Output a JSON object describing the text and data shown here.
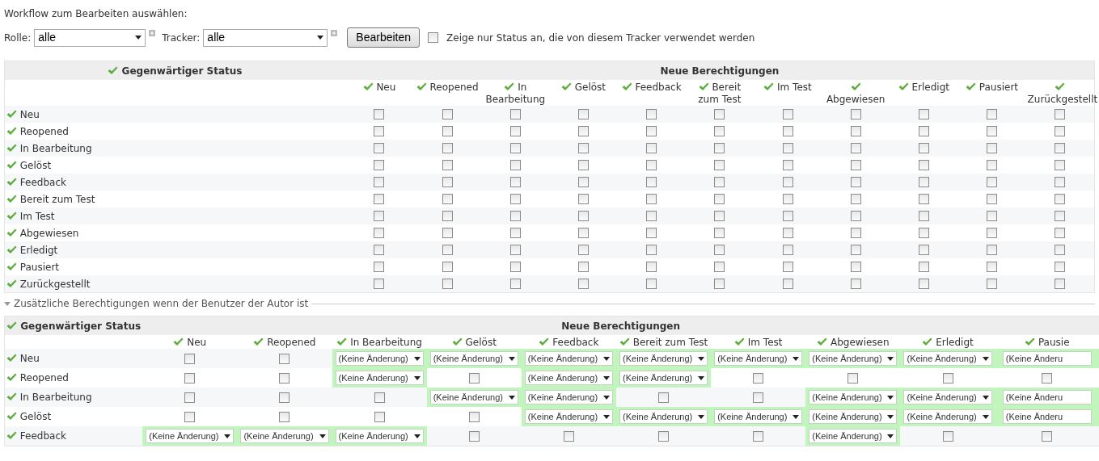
{
  "heading": "Workflow zum Bearbeiten auswählen:",
  "filters": {
    "role_label": "Rolle:",
    "role_value": "alle",
    "tracker_label": "Tracker:",
    "tracker_value": "alle",
    "submit": "Bearbeiten",
    "only_used": {
      "label": "Zeige nur Status an, die von diesem Tracker verwendet werden",
      "checked": false
    }
  },
  "main_table": {
    "status_header": "Gegenwärtiger Status",
    "permissions_header": "Neue Berechtigungen",
    "columns": [
      "Neu",
      "Reopened",
      "In Bearbeitung",
      "Gelöst",
      "Feedback",
      "Bereit zum Test",
      "Im Test",
      "Abgewiesen",
      "Erledigt",
      "Pausiert",
      "Zurückgestellt"
    ],
    "rows": [
      {
        "label": "Neu",
        "cells": [
          {
            "checked": false
          },
          {
            "checked": false
          },
          {
            "checked": false
          },
          {
            "checked": false
          },
          {
            "checked": false
          },
          {
            "checked": false
          },
          {
            "checked": false
          },
          {
            "checked": false
          },
          {
            "checked": false
          },
          {
            "checked": false
          },
          {
            "checked": false
          }
        ]
      },
      {
        "label": "Reopened",
        "cells": [
          {
            "checked": false
          },
          {
            "checked": false
          },
          {
            "checked": false
          },
          {
            "checked": false
          },
          {
            "checked": false
          },
          {
            "checked": false
          },
          {
            "checked": false
          },
          {
            "checked": false
          },
          {
            "checked": false
          },
          {
            "checked": false
          },
          {
            "checked": false
          }
        ]
      },
      {
        "label": "In Bearbeitung",
        "cells": [
          {
            "checked": false
          },
          {
            "checked": false
          },
          {
            "checked": false
          },
          {
            "checked": false
          },
          {
            "checked": false
          },
          {
            "checked": false
          },
          {
            "checked": false
          },
          {
            "checked": false
          },
          {
            "checked": false
          },
          {
            "checked": false
          },
          {
            "checked": false
          }
        ]
      },
      {
        "label": "Gelöst",
        "cells": [
          {
            "checked": false
          },
          {
            "checked": false
          },
          {
            "checked": false
          },
          {
            "checked": false
          },
          {
            "checked": false
          },
          {
            "checked": false
          },
          {
            "checked": false
          },
          {
            "checked": false
          },
          {
            "checked": false
          },
          {
            "checked": false
          },
          {
            "checked": false
          }
        ]
      },
      {
        "label": "Feedback",
        "cells": [
          {
            "checked": false
          },
          {
            "checked": false
          },
          {
            "checked": false
          },
          {
            "checked": false
          },
          {
            "checked": false
          },
          {
            "checked": false
          },
          {
            "checked": false
          },
          {
            "checked": false
          },
          {
            "checked": false
          },
          {
            "checked": false
          },
          {
            "checked": false
          }
        ]
      },
      {
        "label": "Bereit zum Test",
        "cells": [
          {
            "checked": false
          },
          {
            "checked": false
          },
          {
            "checked": false
          },
          {
            "checked": false
          },
          {
            "checked": false
          },
          {
            "checked": false
          },
          {
            "checked": false
          },
          {
            "checked": false
          },
          {
            "checked": false
          },
          {
            "checked": false
          },
          {
            "checked": false
          }
        ]
      },
      {
        "label": "Im Test",
        "cells": [
          {
            "checked": false
          },
          {
            "checked": false
          },
          {
            "checked": false
          },
          {
            "checked": false
          },
          {
            "checked": false
          },
          {
            "checked": false
          },
          {
            "checked": false
          },
          {
            "checked": false
          },
          {
            "checked": false
          },
          {
            "checked": false
          },
          {
            "checked": false
          }
        ]
      },
      {
        "label": "Abgewiesen",
        "cells": [
          {
            "checked": false
          },
          {
            "checked": false
          },
          {
            "checked": false
          },
          {
            "checked": false
          },
          {
            "checked": false
          },
          {
            "checked": false
          },
          {
            "checked": false
          },
          {
            "checked": false
          },
          {
            "checked": false
          },
          {
            "checked": false
          },
          {
            "checked": false
          }
        ]
      },
      {
        "label": "Erledigt",
        "cells": [
          {
            "checked": false
          },
          {
            "checked": false
          },
          {
            "checked": false
          },
          {
            "checked": false
          },
          {
            "checked": false
          },
          {
            "checked": false
          },
          {
            "checked": false
          },
          {
            "checked": false
          },
          {
            "checked": false
          },
          {
            "checked": false
          },
          {
            "checked": false
          }
        ]
      },
      {
        "label": "Pausiert",
        "cells": [
          {
            "checked": false
          },
          {
            "checked": false
          },
          {
            "checked": false
          },
          {
            "checked": false
          },
          {
            "checked": false
          },
          {
            "checked": false
          },
          {
            "checked": false
          },
          {
            "checked": false
          },
          {
            "checked": false
          },
          {
            "checked": false
          },
          {
            "checked": false
          }
        ]
      },
      {
        "label": "Zurückgestellt",
        "cells": [
          {
            "checked": false
          },
          {
            "checked": false
          },
          {
            "checked": false
          },
          {
            "checked": false
          },
          {
            "checked": false
          },
          {
            "checked": false
          },
          {
            "checked": false
          },
          {
            "checked": false
          },
          {
            "checked": false
          },
          {
            "checked": false
          },
          {
            "checked": false
          }
        ]
      }
    ]
  },
  "author_section": {
    "legend": "Zusätzliche Berechtigungen wenn der Benutzer der Autor ist",
    "expanded": true,
    "table": {
      "status_header": "Gegenwärtiger Status",
      "permissions_header": "Neue Berechtigungen",
      "columns": [
        "Neu",
        "Reopened",
        "In Bearbeitung",
        "Gelöst",
        "Feedback",
        "Bereit zum Test",
        "Im Test",
        "Abgewiesen",
        "Erledigt",
        "Pausie"
      ],
      "rows": [
        {
          "label": "Neu",
          "cells": [
            {
              "kind": "checkbox",
              "checked": false
            },
            {
              "kind": "checkbox",
              "checked": false
            },
            {
              "kind": "select",
              "value": "(Keine Änderung)"
            },
            {
              "kind": "select",
              "value": "(Keine Änderung)"
            },
            {
              "kind": "select",
              "value": "(Keine Änderung)"
            },
            {
              "kind": "select",
              "value": "(Keine Änderung)"
            },
            {
              "kind": "select",
              "value": "(Keine Änderung)"
            },
            {
              "kind": "select",
              "value": "(Keine Änderung)"
            },
            {
              "kind": "select",
              "value": "(Keine Änderung)"
            },
            {
              "kind": "select",
              "value": "(Keine Änderu"
            }
          ]
        },
        {
          "label": "Reopened",
          "cells": [
            {
              "kind": "checkbox",
              "checked": false
            },
            {
              "kind": "checkbox",
              "checked": false
            },
            {
              "kind": "select",
              "value": "(Keine Änderung)"
            },
            {
              "kind": "checkbox",
              "checked": false
            },
            {
              "kind": "select",
              "value": "(Keine Änderung)"
            },
            {
              "kind": "select",
              "value": "(Keine Änderung)"
            },
            {
              "kind": "checkbox",
              "checked": false
            },
            {
              "kind": "checkbox",
              "checked": false
            },
            {
              "kind": "checkbox",
              "checked": false
            },
            {
              "kind": "checkbox",
              "checked": false
            }
          ]
        },
        {
          "label": "In Bearbeitung",
          "cells": [
            {
              "kind": "checkbox",
              "checked": false
            },
            {
              "kind": "checkbox",
              "checked": false
            },
            {
              "kind": "checkbox",
              "checked": false
            },
            {
              "kind": "select",
              "value": "(Keine Änderung)"
            },
            {
              "kind": "select",
              "value": "(Keine Änderung)"
            },
            {
              "kind": "checkbox",
              "checked": false
            },
            {
              "kind": "checkbox",
              "checked": false
            },
            {
              "kind": "select",
              "value": "(Keine Änderung)"
            },
            {
              "kind": "select",
              "value": "(Keine Änderung)"
            },
            {
              "kind": "select",
              "value": "(Keine Änderu"
            }
          ]
        },
        {
          "label": "Gelöst",
          "cells": [
            {
              "kind": "checkbox",
              "checked": false
            },
            {
              "kind": "checkbox",
              "checked": false
            },
            {
              "kind": "checkbox",
              "checked": false
            },
            {
              "kind": "checkbox",
              "checked": false
            },
            {
              "kind": "select",
              "value": "(Keine Änderung)"
            },
            {
              "kind": "select",
              "value": "(Keine Änderung)"
            },
            {
              "kind": "select",
              "value": "(Keine Änderung)"
            },
            {
              "kind": "select",
              "value": "(Keine Änderung)"
            },
            {
              "kind": "select",
              "value": "(Keine Änderung)"
            },
            {
              "kind": "select",
              "value": "(Keine Änderu"
            }
          ]
        },
        {
          "label": "Feedback",
          "cells": [
            {
              "kind": "select",
              "value": "(Keine Änderung)"
            },
            {
              "kind": "select",
              "value": "(Keine Änderung)"
            },
            {
              "kind": "select",
              "value": "(Keine Änderung)"
            },
            {
              "kind": "checkbox",
              "checked": false
            },
            {
              "kind": "checkbox",
              "checked": false
            },
            {
              "kind": "checkbox",
              "checked": false
            },
            {
              "kind": "checkbox",
              "checked": false
            },
            {
              "kind": "select",
              "value": "(Keine Änderung)"
            },
            {
              "kind": "checkbox",
              "checked": false
            },
            {
              "kind": "checkbox",
              "checked": false
            }
          ]
        }
      ]
    }
  }
}
